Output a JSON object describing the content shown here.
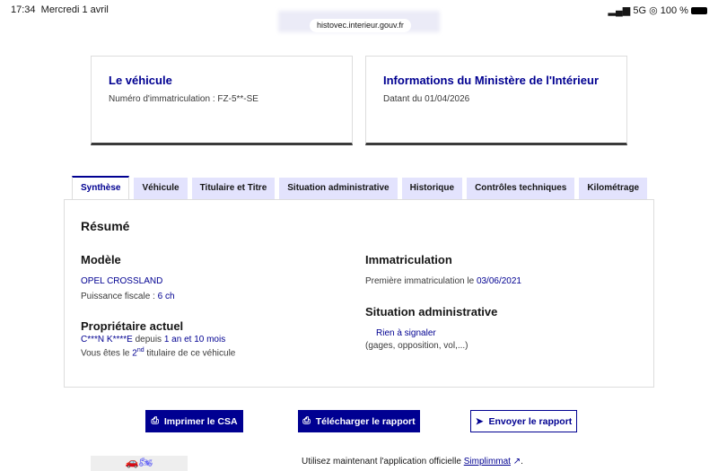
{
  "status": {
    "time": "17:34",
    "date": "Mercredi 1 avril",
    "signal": "5G",
    "battery": "100 %"
  },
  "browser": {
    "url": "histovec.interieur.gouv.fr"
  },
  "cards": [
    {
      "title": "Le véhicule",
      "text": "Numéro d'immatriculation : FZ-5**-SE"
    },
    {
      "title": "Informations du Ministère de l'Intérieur",
      "text": "Datant du 01/04/2026"
    }
  ],
  "tabs": [
    "Synthèse",
    "Véhicule",
    "Titulaire et Titre",
    "Situation administrative",
    "Historique",
    "Contrôles techniques",
    "Kilométrage"
  ],
  "summary": {
    "title": "Résumé",
    "model_h": "Modèle",
    "model": "OPEL CROSSLAND",
    "power_label": "Puissance fiscale : ",
    "power": "6 ch",
    "owner_h": "Propriétaire actuel",
    "owner": "C***N K****E",
    "since_label": " depuis ",
    "since": "1 an et 10 mois",
    "rank_pre": "Vous êtes le ",
    "rank": "2",
    "rank_sup": "nd",
    "rank_post": " titulaire de ce véhicule",
    "immat_h": "Immatriculation",
    "immat_label": "Première immatriculation le ",
    "immat_date": "03/06/2021",
    "admin_h": "Situation administrative",
    "admin_status": "Rien à signaler",
    "admin_note": "(gages, opposition, vol,...)"
  },
  "buttons": {
    "print": "Imprimer le CSA",
    "download": "Télécharger le rapport",
    "send": "Envoyer le rapport"
  },
  "footer": {
    "text": "Utilisez maintenant l'application officielle ",
    "link": "Simplimmat"
  }
}
